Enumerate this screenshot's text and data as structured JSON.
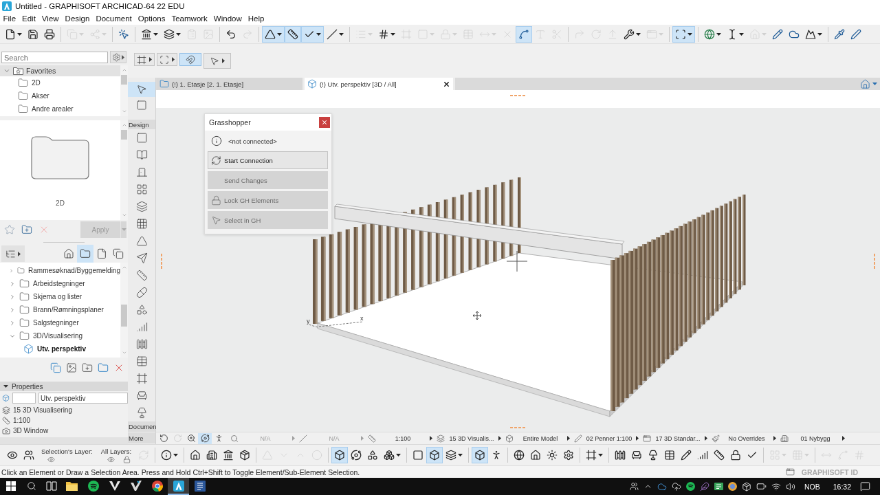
{
  "window": {
    "title": "Untitled - GRAPHISOFT ARCHICAD-64 22 EDU"
  },
  "menu": [
    "File",
    "Edit",
    "View",
    "Design",
    "Document",
    "Options",
    "Teamwork",
    "Window",
    "Help"
  ],
  "toolbar": {
    "buttons": [
      {
        "on": false,
        "disabled": false
      },
      {
        "on": false,
        "disabled": false
      },
      {
        "on": false,
        "disabled": false
      },
      {
        "on": false,
        "disabled": true
      },
      {
        "on": false,
        "disabled": true
      },
      {
        "on": false,
        "disabled": false
      },
      {
        "on": false,
        "disabled": false
      },
      {
        "on": false,
        "disabled": false
      },
      {
        "on": false,
        "disabled": true
      },
      {
        "on": false,
        "disabled": true
      },
      {
        "on": false,
        "disabled": false
      },
      {
        "on": false,
        "disabled": true
      },
      {
        "on": true,
        "disabled": false
      },
      {
        "on": true,
        "disabled": false
      },
      {
        "on": true,
        "disabled": false
      },
      {
        "on": false,
        "disabled": false
      },
      {
        "on": false,
        "disabled": true
      },
      {
        "on": false,
        "disabled": false
      },
      {
        "on": false,
        "disabled": true
      },
      {
        "on": false,
        "disabled": true
      },
      {
        "on": false,
        "disabled": true
      },
      {
        "on": false,
        "disabled": true
      },
      {
        "on": false,
        "disabled": true
      },
      {
        "on": false,
        "disabled": true
      },
      {
        "on": true,
        "disabled": false
      },
      {
        "on": false,
        "disabled": true
      },
      {
        "on": false,
        "disabled": true
      },
      {
        "on": false,
        "disabled": true
      },
      {
        "on": false,
        "disabled": true
      },
      {
        "on": false,
        "disabled": true
      },
      {
        "on": false,
        "disabled": false
      },
      {
        "on": false,
        "disabled": true
      },
      {
        "on": true,
        "disabled": false
      },
      {
        "on": false,
        "disabled": false
      },
      {
        "on": false,
        "disabled": false
      },
      {
        "on": false,
        "disabled": true
      },
      {
        "on": false,
        "disabled": false
      },
      {
        "on": false,
        "disabled": false
      },
      {
        "on": false,
        "disabled": false
      },
      {
        "on": false,
        "disabled": false
      },
      {
        "on": false,
        "disabled": false
      }
    ]
  },
  "navigator": {
    "search": {
      "placeholder": "Search"
    },
    "favorites": {
      "title": "Favorites",
      "expanded": true,
      "items": [
        {
          "label": "2D",
          "selected": false
        },
        {
          "label": "Akser",
          "selected": false
        },
        {
          "label": "Andre arealer",
          "selected": false
        }
      ]
    },
    "preview": {
      "caption": "2D"
    },
    "apply_button": {
      "label": "Apply",
      "disabled": true
    },
    "map_tabs": [
      {
        "selected": false
      },
      {
        "selected": true
      },
      {
        "selected": false
      },
      {
        "selected": false
      }
    ],
    "tree": [
      {
        "label": "Rammesøknad/Byggemelding",
        "expanded": false,
        "selected": false
      },
      {
        "label": "Arbeidstegninger",
        "expanded": false,
        "selected": false
      },
      {
        "label": "Skjema og lister",
        "expanded": false,
        "selected": false
      },
      {
        "label": "Brann/Rømningsplaner",
        "expanded": false,
        "selected": false
      },
      {
        "label": "Salgstegninger",
        "expanded": false,
        "selected": false
      },
      {
        "label": "3D/Visualisering",
        "expanded": true,
        "selected": false,
        "children": [
          {
            "label": "Utv. perspektiv",
            "selected": true
          }
        ]
      }
    ]
  },
  "properties": {
    "title": "Properties",
    "expanded": true,
    "name": "Utv. perspektiv",
    "layer": "15 3D Visualisering",
    "scale": "1:100",
    "type": "3D Window"
  },
  "info_box": {
    "buttons": [
      {
        "on": false
      },
      {
        "on": false
      },
      {
        "on": true
      },
      {
        "on": false
      }
    ]
  },
  "toolbox": {
    "selection_tools": [
      {
        "selected": true
      },
      {
        "selected": false
      }
    ],
    "design_label": "Design",
    "design_tools": [
      {
        "selected": false
      },
      {
        "selected": false
      },
      {
        "selected": false
      },
      {
        "selected": false
      },
      {
        "selected": false
      },
      {
        "selected": false
      },
      {
        "selected": false
      },
      {
        "selected": false
      },
      {
        "selected": false
      },
      {
        "selected": false
      },
      {
        "selected": false
      },
      {
        "selected": false
      },
      {
        "selected": false
      },
      {
        "selected": false
      },
      {
        "selected": false
      },
      {
        "selected": false
      },
      {
        "selected": false
      }
    ],
    "document_label": "Documen",
    "more_label": "More"
  },
  "tabs": [
    {
      "label": "(!) 1. Etasje [2. 1. Etasje]",
      "selected": false
    },
    {
      "label": "(!) Utv. perspektiv [3D / All]",
      "selected": true
    }
  ],
  "grasshopper": {
    "title": "Grasshopper",
    "status": "<not connected>",
    "buttons": [
      {
        "label": "Start Connection",
        "disabled": false
      },
      {
        "label": "Send Changes",
        "disabled": true
      },
      {
        "label": "Lock GH Elements",
        "disabled": true
      },
      {
        "label": "Select in GH",
        "disabled": true
      }
    ]
  },
  "viewport": {
    "axis_labels": [
      "y",
      "x"
    ]
  },
  "quick_options": {
    "view_buttons": [
      {
        "on": false,
        "disabled": false
      },
      {
        "on": false,
        "disabled": true
      },
      {
        "on": false,
        "disabled": false
      },
      {
        "on": true,
        "disabled": false
      },
      {
        "on": false,
        "disabled": false
      }
    ],
    "fields": [
      {
        "value": "N/A",
        "disabled": true
      },
      {
        "value": "N/A",
        "disabled": true
      },
      {
        "value": "1:100",
        "disabled": false
      },
      {
        "value": "15 3D Visualis...",
        "disabled": false
      },
      {
        "value": "Entire Model",
        "disabled": false
      },
      {
        "value": "02 Penner 1:100",
        "disabled": false
      },
      {
        "value": "17 3D Standar...",
        "disabled": false
      },
      {
        "value": "No Overrides",
        "disabled": false
      },
      {
        "value": "01 Nybygg",
        "disabled": false
      }
    ]
  },
  "bottom_toolbar": {
    "selection_layer_label": "Selection's Layer:",
    "all_layers_label": "All Layers:",
    "buttons": [
      {
        "on": false,
        "disabled": false
      },
      {
        "on": false,
        "disabled": false
      },
      {
        "on": false,
        "disabled": true
      },
      {
        "on": false,
        "disabled": false
      },
      {
        "on": false,
        "disabled": false
      },
      {
        "on": false,
        "disabled": false
      },
      {
        "on": false,
        "disabled": false
      },
      {
        "on": false,
        "disabled": false
      },
      {
        "on": false,
        "disabled": true
      },
      {
        "on": false,
        "disabled": true
      },
      {
        "on": false,
        "disabled": true
      },
      {
        "on": false,
        "disabled": true
      },
      {
        "on": true,
        "disabled": false
      },
      {
        "on": false,
        "disabled": false
      },
      {
        "on": false,
        "disabled": false
      },
      {
        "on": false,
        "disabled": false
      },
      {
        "on": false,
        "disabled": false
      },
      {
        "on": true,
        "disabled": false
      },
      {
        "on": false,
        "disabled": false
      },
      {
        "on": true,
        "disabled": false
      },
      {
        "on": false,
        "disabled": false
      },
      {
        "on": false,
        "disabled": false
      },
      {
        "on": false,
        "disabled": false
      },
      {
        "on": false,
        "disabled": false
      },
      {
        "on": false,
        "disabled": false
      },
      {
        "on": false,
        "disabled": false
      },
      {
        "on": false,
        "disabled": false
      },
      {
        "on": false,
        "disabled": false
      },
      {
        "on": false,
        "disabled": false
      },
      {
        "on": false,
        "disabled": false
      },
      {
        "on": false,
        "disabled": false
      },
      {
        "on": false,
        "disabled": false
      },
      {
        "on": false,
        "disabled": false
      },
      {
        "on": false,
        "disabled": false
      },
      {
        "on": false,
        "disabled": false
      },
      {
        "on": false,
        "disabled": true
      },
      {
        "on": false,
        "disabled": true
      },
      {
        "on": false,
        "disabled": true
      },
      {
        "on": false,
        "disabled": true
      },
      {
        "on": false,
        "disabled": true
      }
    ]
  },
  "status_bar": {
    "message": "Click an Element or Draw a Selection Area. Press and Hold Ctrl+Shift to Toggle Element/Sub-Element Selection.",
    "account": "GRAPHISOFT ID"
  },
  "taskbar": {
    "apps": [
      {
        "active": false
      },
      {
        "active": false
      },
      {
        "active": false
      },
      {
        "active": false
      },
      {
        "active": false
      },
      {
        "active": true
      },
      {
        "active": false
      }
    ],
    "language": "NOB",
    "time": "16:32"
  }
}
